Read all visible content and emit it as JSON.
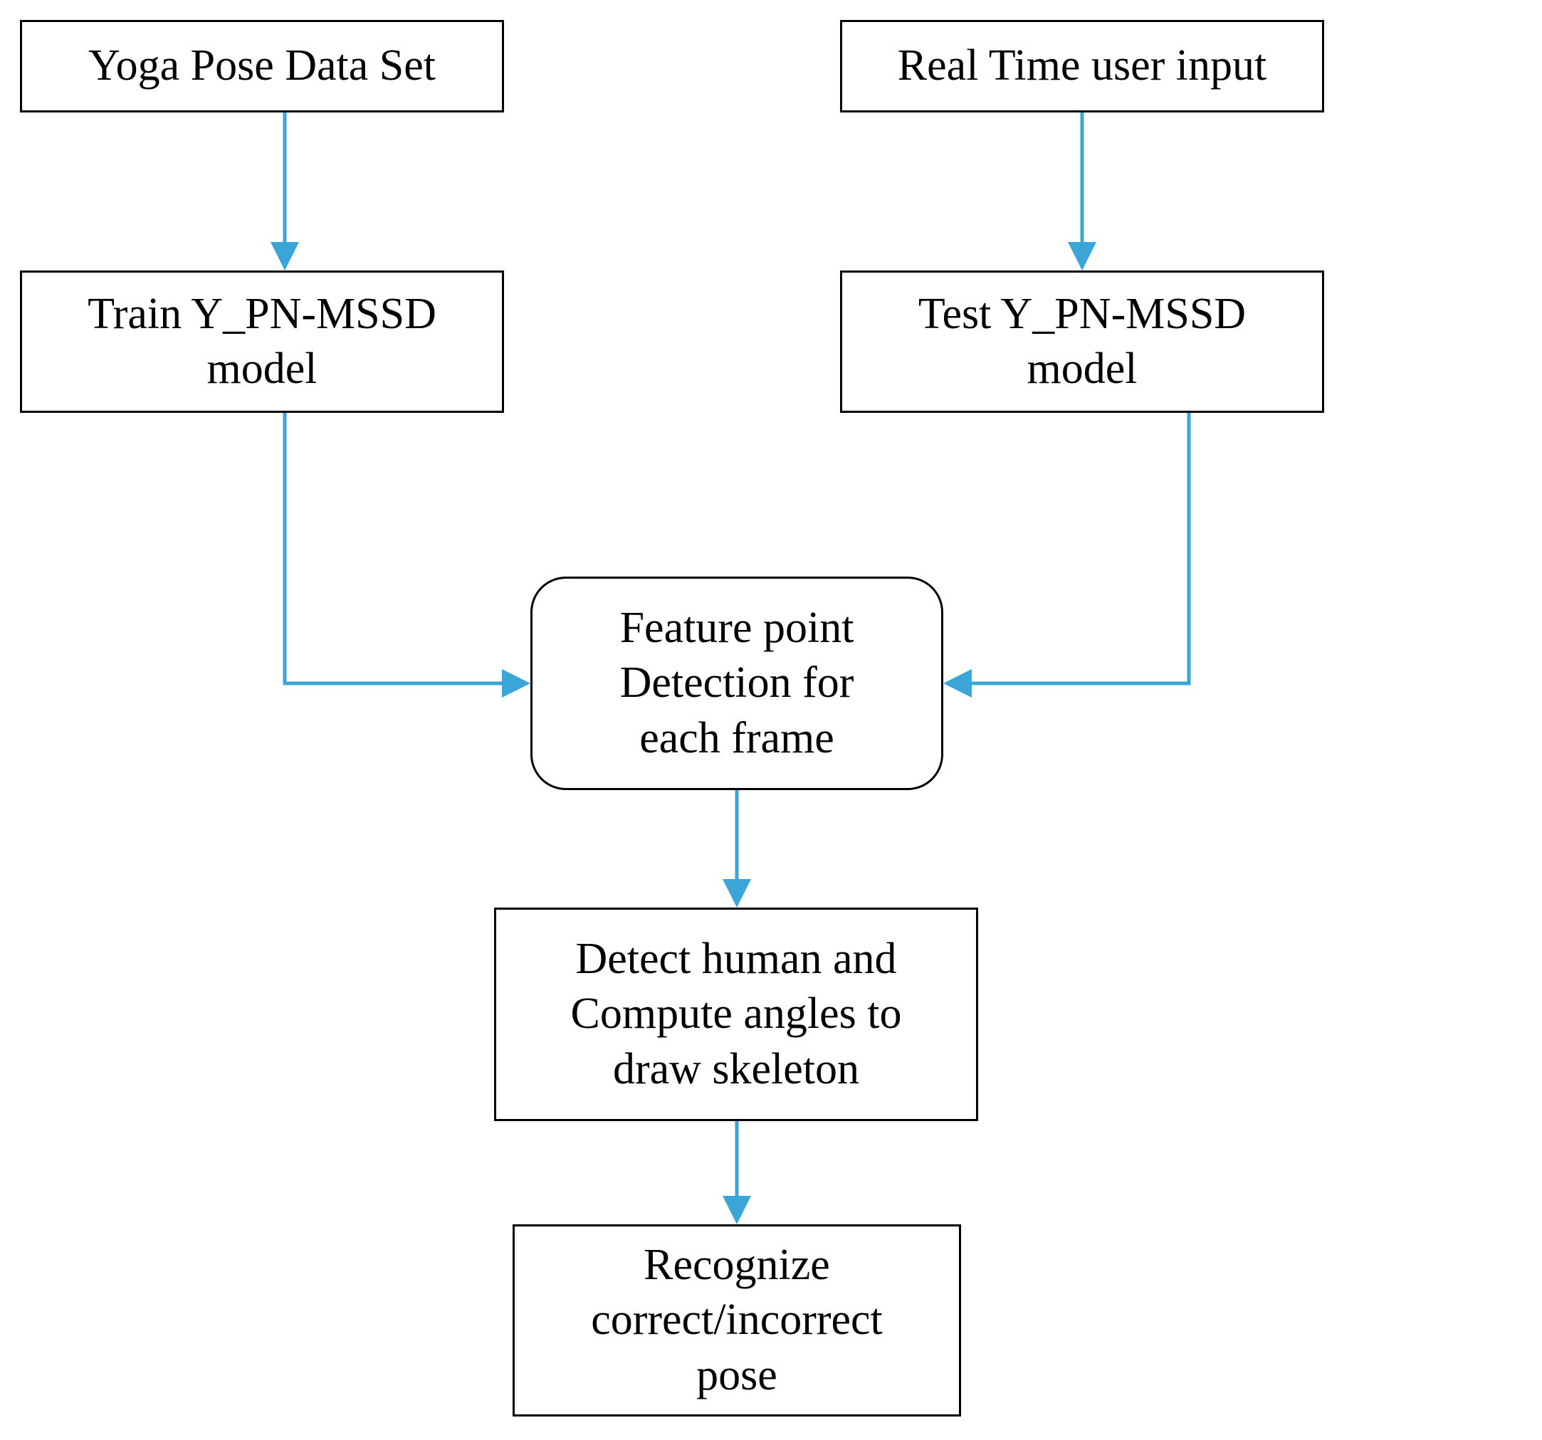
{
  "nodes": {
    "dataset": {
      "text": "Yoga Pose Data Set"
    },
    "userin": {
      "text": "Real Time user input"
    },
    "train": {
      "text": "Train Y_PN-MSSD\nmodel"
    },
    "test": {
      "text": "Test Y_PN-MSSD\nmodel"
    },
    "feature": {
      "text": "Feature point\nDetection for\neach frame"
    },
    "detect": {
      "text": "Detect human and\nCompute angles to\ndraw skeleton"
    },
    "recog": {
      "text": "Recognize\ncorrect/incorrect\npose"
    }
  },
  "colors": {
    "arrow": "#3aa6d8"
  }
}
